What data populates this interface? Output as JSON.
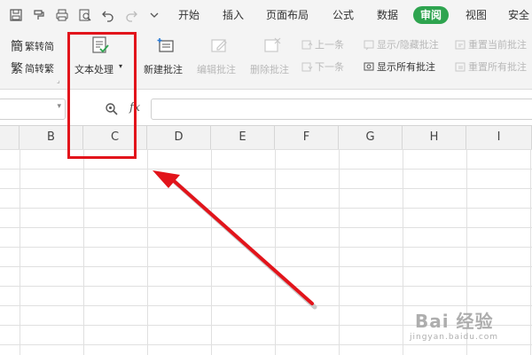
{
  "menu": {
    "start": "开始",
    "insert": "插入",
    "page_layout": "页面布局",
    "formulas": "公式",
    "data": "数据",
    "review": "审阅",
    "view": "视图",
    "security": "安全"
  },
  "ribbon": {
    "trad_to_simp": "繁转简",
    "simp_to_trad": "简转繁",
    "text_processing": "文本处理",
    "new_comment": "新建批注",
    "edit_comment": "编辑批注",
    "delete_comment": "删除批注",
    "previous": "上一条",
    "next": "下一条",
    "show_hide_comment": "显示/隐藏批注",
    "show_all_comments": "显示所有批注",
    "reset_current_comment": "重置当前批注",
    "reset_all_comments": "重置所有批注",
    "dropdown_glyph": "▾"
  },
  "formula_bar": {
    "fx_label": "fx",
    "namebox_dropdown": "▾"
  },
  "columns": [
    "B",
    "C",
    "D",
    "E",
    "F",
    "G",
    "H",
    "I"
  ],
  "watermark": {
    "main": "Bai 经验",
    "sub": "jingyan.baidu.com"
  },
  "colors": {
    "review_tab": "#2ea44f",
    "highlight_box": "#e2141b",
    "arrow": "#e2141b"
  }
}
